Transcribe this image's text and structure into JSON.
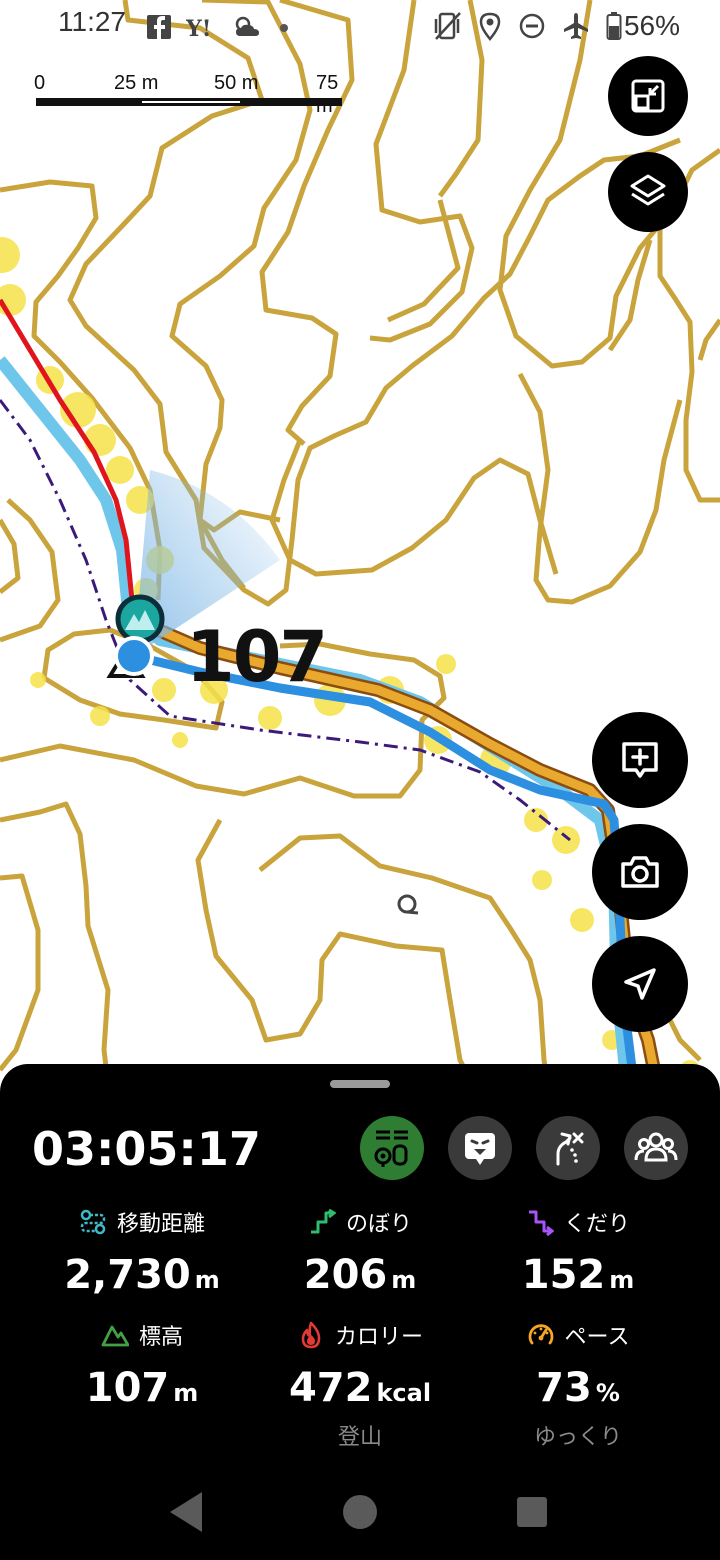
{
  "status_bar": {
    "time": "11:27",
    "battery": "56%",
    "left_icons": [
      "facebook-icon",
      "yahoo-icon",
      "weather-icon",
      "dot-icon"
    ],
    "right_icons": [
      "vibrate-off-icon",
      "location-icon",
      "dnd-icon",
      "airplane-icon",
      "battery-icon"
    ]
  },
  "scale": {
    "labels": [
      "0",
      "25 m",
      "50 m",
      "75 m"
    ]
  },
  "map": {
    "elevation_label": "107",
    "colors": {
      "contour": "#c9a43c",
      "red_route": "#e0141c",
      "light_blue_route": "#6ec6ea",
      "blue_track": "#2d8fe0",
      "orange_route": "#e9a92e",
      "heat": "#f6e24a",
      "purple_trail": "#3c1a7a"
    }
  },
  "map_buttons": {
    "collapse": "collapse-map-icon",
    "layers": "layers-icon",
    "add_memo": "add-memo-icon",
    "camera": "camera-icon",
    "navigate": "navigate-icon"
  },
  "sheet": {
    "timer": "03:05:17",
    "mode_buttons": [
      "track-mode-icon",
      "face-icon",
      "route-off-icon",
      "group-icon"
    ],
    "stats": {
      "distance": {
        "label": "移動距離",
        "value": "2,730",
        "unit": "m",
        "icon_color": "#3fb8c9"
      },
      "ascent": {
        "label": "のぼり",
        "value": "206",
        "unit": "m",
        "icon_color": "#2ebd6b"
      },
      "descent": {
        "label": "くだり",
        "value": "152",
        "unit": "m",
        "icon_color": "#a855f7"
      },
      "elevation": {
        "label": "標高",
        "value": "107",
        "unit": "m",
        "icon_color": "#43a047"
      },
      "calories": {
        "label": "カロリー",
        "value": "472",
        "unit": "kcal",
        "sub": "登山",
        "icon_color": "#e53935"
      },
      "pace": {
        "label": "ペース",
        "value": "73",
        "unit": "%",
        "sub": "ゆっくり",
        "icon_color": "#f5a623"
      }
    }
  },
  "navbar": {
    "back": "back-icon",
    "home": "home-icon",
    "recents": "recents-icon"
  }
}
